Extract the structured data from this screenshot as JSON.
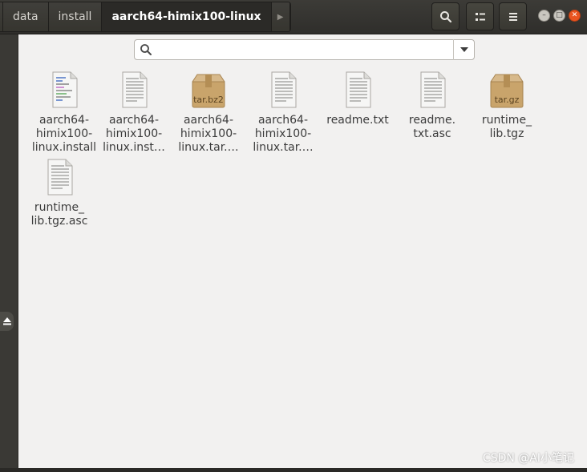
{
  "breadcrumbs": [
    "data",
    "install",
    "aarch64-himix100-linux"
  ],
  "search": {
    "value": "",
    "placeholder": ""
  },
  "files": [
    {
      "label": "aarch64-\nhimix100-\nlinux.install",
      "type": "text"
    },
    {
      "label": "aarch64-\nhimix100-\nlinux.inst…",
      "type": "text"
    },
    {
      "label": "aarch64-\nhimix100-\nlinux.tar.…",
      "type": "archive",
      "badge": "tar.bz2"
    },
    {
      "label": "aarch64-\nhimix100-\nlinux.tar.…",
      "type": "text"
    },
    {
      "label": "readme.txt",
      "type": "text"
    },
    {
      "label": "readme.\ntxt.asc",
      "type": "text"
    },
    {
      "label": "runtime_\nlib.tgz",
      "type": "archive",
      "badge": "tar.gz"
    },
    {
      "label": "runtime_\nlib.tgz.asc",
      "type": "text"
    }
  ],
  "watermark": "CSDN @AI小笔记",
  "colors": {
    "accent": "#e95420",
    "headerbar": "#3c3b37",
    "background": "#f2f1f0",
    "archive": "#c9a46b"
  }
}
